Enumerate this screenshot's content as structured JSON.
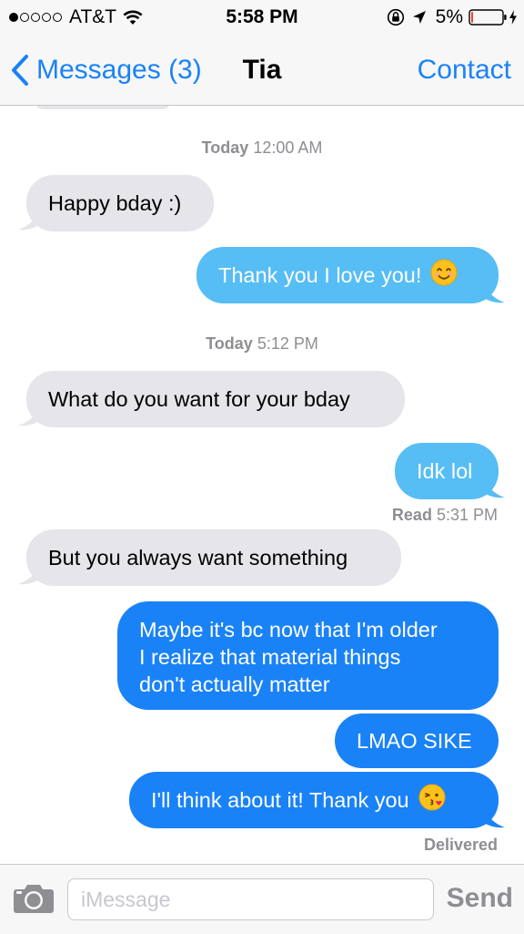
{
  "status_bar": {
    "signal": "●oooo",
    "carrier": "AT&T",
    "time": "5:58 PM",
    "battery_percent": "5%",
    "battery_level": 0.05,
    "icons": [
      "wifi-icon",
      "rotation-lock-icon",
      "location-arrow-icon",
      "battery-icon",
      "charging-bolt-icon"
    ]
  },
  "nav": {
    "back_label": "Messages (3)",
    "title": "Tia",
    "contact_label": "Contact"
  },
  "conversation": {
    "timestamps": [
      {
        "day": "Today",
        "time": "12:00 AM"
      },
      {
        "day": "Today",
        "time": "5:12 PM"
      }
    ],
    "messages": [
      {
        "direction": "incoming",
        "text": "Happy bday :)"
      },
      {
        "direction": "outgoing",
        "text": "Thank you I love you!",
        "emoji": "smiling-face-emoji"
      },
      {
        "direction": "incoming",
        "text": "What do you want for your bday"
      },
      {
        "direction": "outgoing",
        "text": "Idk lol"
      },
      {
        "direction": "incoming",
        "text": "But you always want something"
      },
      {
        "direction": "outgoing",
        "text": "Maybe it's bc now that I'm older\nI realize that material things\ndon't actually matter"
      },
      {
        "direction": "outgoing",
        "text": "LMAO SIKE"
      },
      {
        "direction": "outgoing",
        "text": "I'll think about it! Thank you",
        "emoji": "kissing-face-emoji"
      }
    ],
    "read_receipt": {
      "label": "Read",
      "time": "5:31 PM"
    },
    "delivered_label": "Delivered"
  },
  "input_bar": {
    "placeholder": "iMessage",
    "value": "",
    "send_label": "Send"
  },
  "colors": {
    "accent": "#1a82f7",
    "imessage_bubble": "#1a82f7",
    "light_blue_bubble": "#56bdf5",
    "incoming_bubble": "#e5e5ea",
    "secondary_text": "#8e8e93",
    "battery_low": "#ff3b30"
  }
}
